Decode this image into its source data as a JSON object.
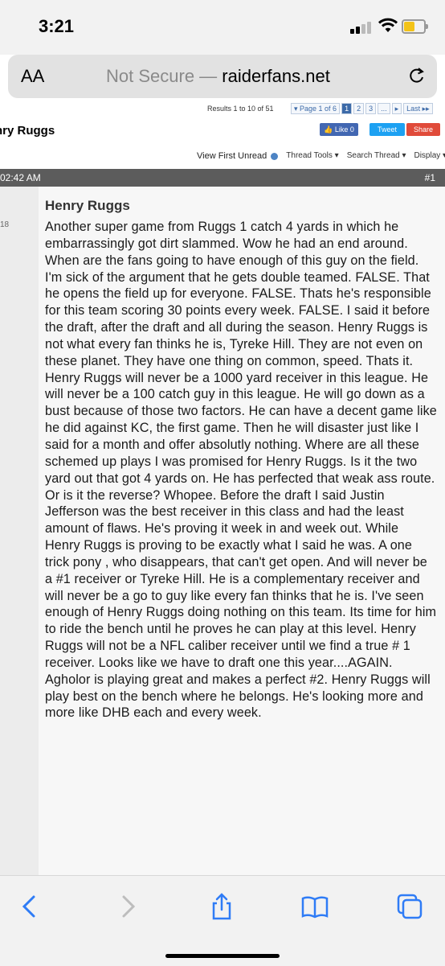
{
  "status": {
    "time": "3:21"
  },
  "browser": {
    "aa_label": "AA",
    "not_secure": "Not Secure —",
    "domain": "raiderfans.net"
  },
  "thread": {
    "results_text": "Results 1 to 10 of 51",
    "pager": [
      "▾ Page 1 of 6",
      "1",
      "2",
      "3",
      "...",
      "▸",
      "Last ▸▸"
    ],
    "title": "nry Ruggs",
    "like_label": "👍 Like 0",
    "tweet_label": "Tweet",
    "share_label": "Share",
    "view_first_unread": "View First Unread",
    "thread_tools": "Thread Tools ▾",
    "search_thread": "Search Thread ▾",
    "display": "Display ▾"
  },
  "post": {
    "date": "02:42 AM",
    "number": "#1",
    "side_num": "18",
    "title": "Henry Ruggs",
    "text": "Another super game from Ruggs 1 catch 4 yards in which he embarrassingly got dirt slammed. Wow he had an end around. When are the fans going to have enough of this guy on the field. I'm sick of the argument that he gets double teamed. FALSE. That he opens the field up for everyone. FALSE. Thats he's responsible for this team scoring 30 points every week. FALSE. I said it before the draft, after the draft and all during the season. Henry Ruggs is not what every fan thinks he is, Tyreke Hill. They are not even on these planet. They have one thing on common, speed. Thats it. Henry Ruggs will never be a 1000 yard receiver in this league. He will never be a 100 catch guy in this league. He will go down as a bust because of those two factors. He can have a decent game like he did against KC, the first game. Then he will disaster just like I said for a month and offer absolutly nothing. Where are all these schemed up plays I was promised for Henry Ruggs. Is it the two yard out that got 4 yards on. He has perfected that weak ass route. Or is it the reverse? Whopee. Before the draft I said Justin Jefferson was the best receiver in this class and had the least amount of flaws. He's proving it week in and week out. While Henry Ruggs is proving to be exactly what I said he was. A one trick pony , who disappears, that can't get open. And will never be a #1 receiver or Tyreke Hill. He is a complementary receiver and will never be a go to guy like every fan thinks that he is. I've seen enough of Henry Ruggs doing nothing on this team. Its time for him to ride the bench until he proves he can play at this level. Henry Ruggs will not be a NFL caliber receiver until we find a true # 1 receiver. Looks like we have to draft one this year....AGAIN. Agholor is playing great and makes a perfect #2. Henry Ruggs will play best on the bench where he belongs. He's looking more and more like DHB each and every week."
  },
  "toolbar_icons": [
    "back-icon",
    "forward-icon",
    "share-icon",
    "bookmarks-icon",
    "tabs-icon"
  ],
  "colors": {
    "battery": "#f3c318",
    "header_bar": "#5c5c5c",
    "like": "#4267b2",
    "tweet": "#1da1f2",
    "share": "#e04b3a"
  }
}
